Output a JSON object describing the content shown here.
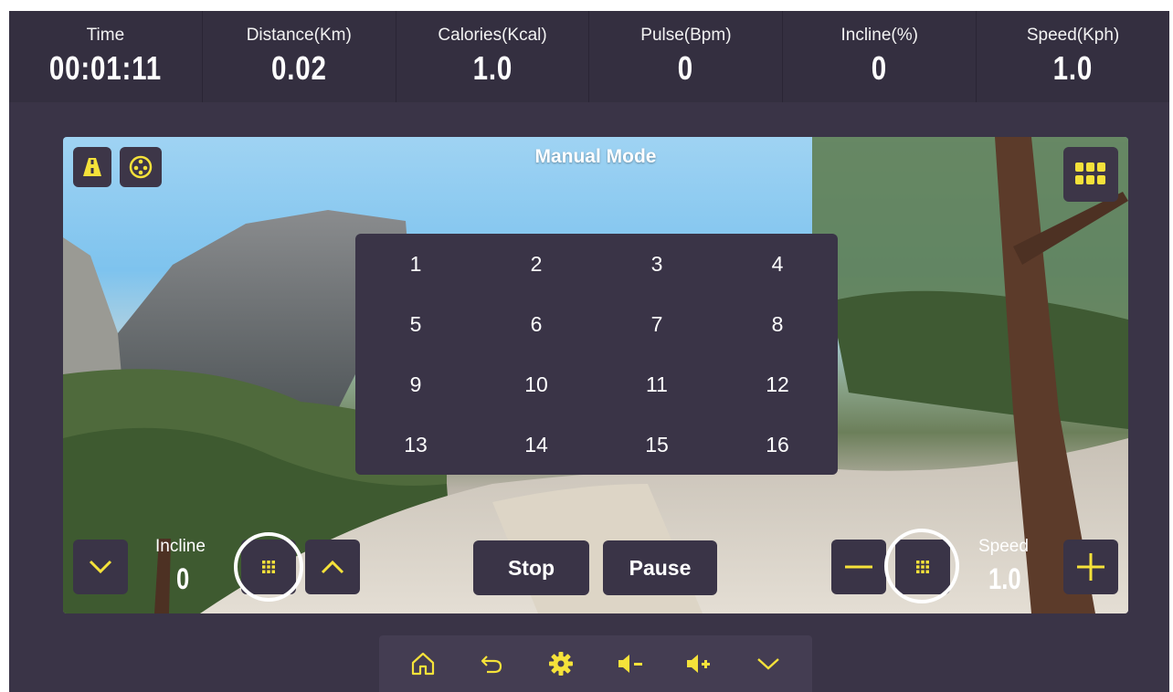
{
  "stats": [
    {
      "label": "Time",
      "value": "00:01:11"
    },
    {
      "label": "Distance(Km)",
      "value": "0.02"
    },
    {
      "label": "Calories(Kcal)",
      "value": "1.0"
    },
    {
      "label": "Pulse(Bpm)",
      "value": "0"
    },
    {
      "label": "Incline(%)",
      "value": "0"
    },
    {
      "label": "Speed(Kph)",
      "value": "1.0"
    }
  ],
  "video": {
    "mode_title": "Manual Mode"
  },
  "numpad": [
    "1",
    "2",
    "3",
    "4",
    "5",
    "6",
    "7",
    "8",
    "9",
    "10",
    "11",
    "12",
    "13",
    "14",
    "15",
    "16"
  ],
  "controls": {
    "incline_label": "Incline",
    "incline_value": "0",
    "speed_label": "Speed",
    "speed_value": "1.0",
    "stop_label": "Stop",
    "pause_label": "Pause"
  },
  "toolbar": {
    "items": [
      "home-icon",
      "back-icon",
      "settings-icon",
      "volume-down-icon",
      "volume-up-icon",
      "chevron-down-icon"
    ]
  },
  "colors": {
    "accent": "#f5e23a",
    "panel": "#3a3447",
    "header": "#342f40",
    "text": "#ffffff"
  }
}
